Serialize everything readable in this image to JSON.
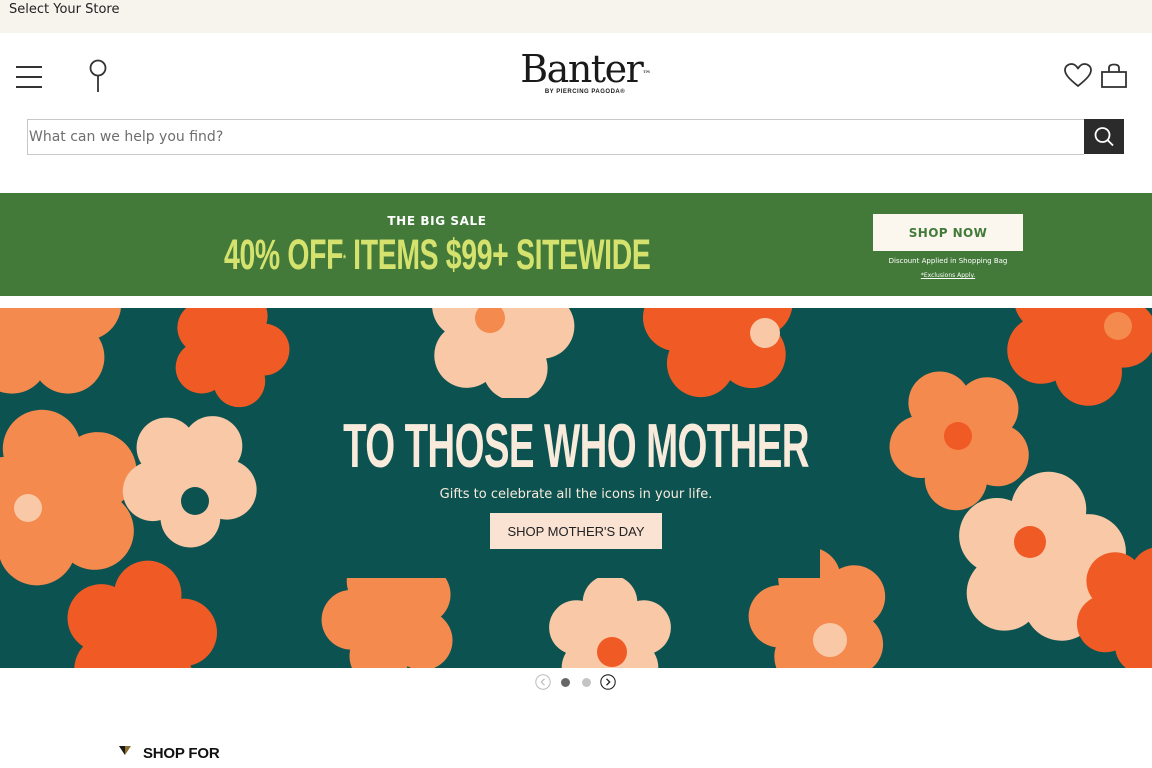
{
  "store_bar": {
    "label": "Select Your Store"
  },
  "header": {
    "logo": {
      "wordmark": "Banter",
      "trademark": "™",
      "byline": "BY PIERCING PAGODA®"
    },
    "icons": [
      "menu-icon",
      "location-pin-icon",
      "heart-icon",
      "shopping-bag-icon"
    ]
  },
  "search": {
    "placeholder": "What can we help you find?",
    "value": ""
  },
  "promo": {
    "kicker": "THE BIG SALE",
    "headline": "40% OFF",
    "headline_mark": "*",
    "headline_rest": " ITEMS $99+ SITEWIDE",
    "cta": "SHOP NOW",
    "note": "Discount Applied in Shopping Bag",
    "exclusions": "*Exclusions Apply.",
    "colors": {
      "background": "#437a3a",
      "headline": "#d6e26e"
    }
  },
  "hero": {
    "title": "TO THOSE WHO MOTHER",
    "subtitle": "Gifts to celebrate all the icons in your life.",
    "cta": "SHOP MOTHER'S DAY",
    "colors": {
      "background": "#0c5250",
      "petal_orange": "#f05a24",
      "petal_coral": "#f48a4e",
      "petal_peach": "#f9c8a6"
    }
  },
  "carousel": {
    "slide_count": 2,
    "active_slide": 1
  },
  "shop_for": {
    "title": "SHOP FOR"
  }
}
